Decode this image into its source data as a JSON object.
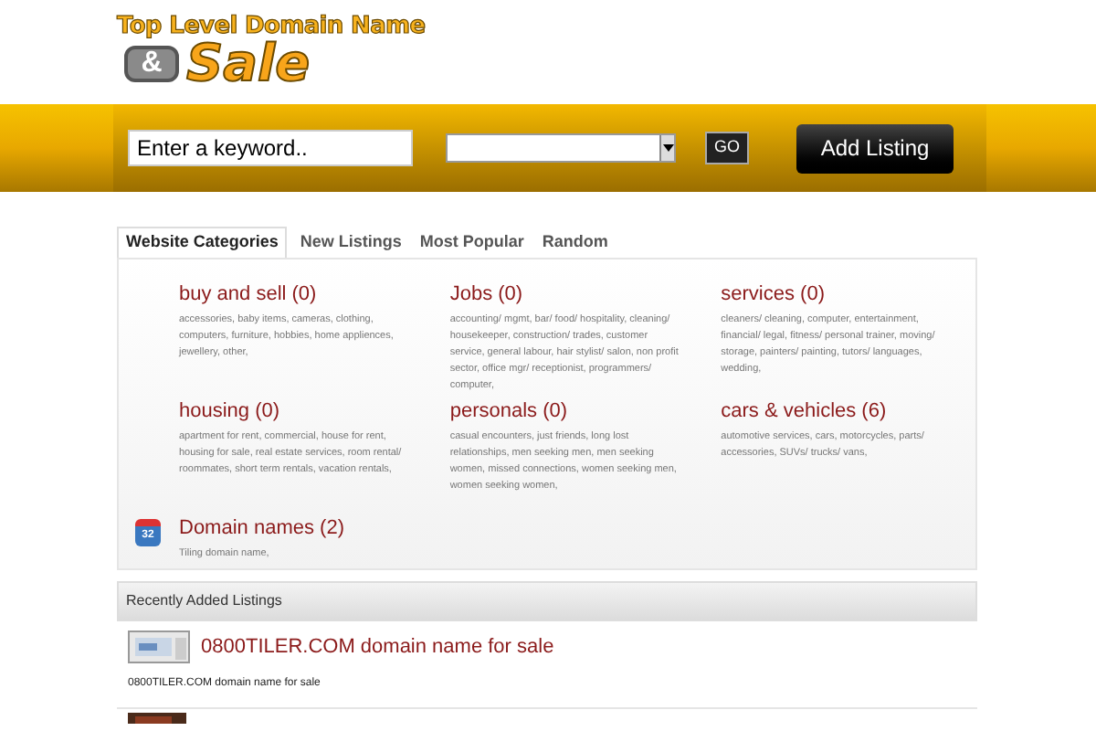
{
  "logo": {
    "line_1": "Top Level Domain Name",
    "ampersand": "&",
    "line_2": "Sale"
  },
  "search": {
    "placeholder": "Enter a keyword..",
    "go": "GO",
    "add_listing": "Add Listing"
  },
  "tabs": [
    {
      "label": "Website Categories",
      "selected": true
    },
    {
      "label": "New Listings",
      "selected": false
    },
    {
      "label": "Most Popular",
      "selected": false
    },
    {
      "label": "Random",
      "selected": false
    }
  ],
  "categories": [
    {
      "title": "buy and sell (0)",
      "description": "accessories, baby items, cameras, clothing, computers, furniture, hobbies, home appliences, jewellery, other,"
    },
    {
      "title": "Jobs (0)",
      "description": "accounting/ mgmt, bar/ food/ hospitality, cleaning/ housekeeper, construction/ trades, customer service, general labour, hair stylist/ salon, non profit sector, office mgr/ receptionist, programmers/ computer,"
    },
    {
      "title": "services (0)",
      "description": "cleaners/ cleaning, computer, entertainment, financial/ legal, fitness/ personal trainer, moving/ storage, painters/ painting, tutors/ languages, wedding,"
    },
    {
      "title": "housing (0)",
      "description": "apartment for rent, commercial, house for rent, housing for sale, real estate services, room rental/ roommates, short term rentals, vacation rentals,"
    },
    {
      "title": "personals (0)",
      "description": "casual encounters, just friends, long lost relationships, men seeking men, men seeking women, missed connections, women seeking men, women seeking women,"
    },
    {
      "title": "cars & vehicles (6)",
      "description": "automotive services, cars, motorcycles, parts/ accessories, SUVs/ trucks/ vans,"
    },
    {
      "title": "Domain names (2)",
      "description": "Tiling domain name,",
      "icon_text": "32"
    }
  ],
  "recent": {
    "heading": "Recently Added Listings",
    "listings": [
      {
        "title": "0800TILER.COM domain name for sale",
        "description": "0800TILER.COM domain name for sale"
      }
    ]
  }
}
